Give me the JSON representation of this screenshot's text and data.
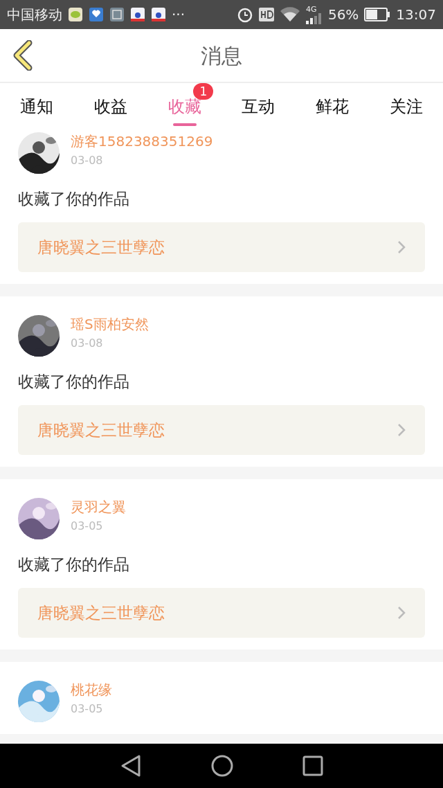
{
  "status_bar": {
    "carrier": "中国移动",
    "overflow": "···",
    "network": "4G",
    "battery": "56%",
    "time": "13:07"
  },
  "header": {
    "title": "消息"
  },
  "tabs": [
    {
      "label": "通知",
      "selected": false
    },
    {
      "label": "收益",
      "selected": false
    },
    {
      "label": "收藏",
      "selected": true,
      "badge": "1"
    },
    {
      "label": "互动",
      "selected": false
    },
    {
      "label": "鲜花",
      "selected": false
    },
    {
      "label": "关注",
      "selected": false
    }
  ],
  "messages": [
    {
      "user": "游客1582388351269",
      "date": "03-08",
      "action": "收藏了你的作品",
      "work": "唐晓翼之三世孽恋"
    },
    {
      "user": "瑶S雨柏安然",
      "date": "03-08",
      "action": "收藏了你的作品",
      "work": "唐晓翼之三世孽恋"
    },
    {
      "user": "灵羽之翼",
      "date": "03-05",
      "action": "收藏了你的作品",
      "work": "唐晓翼之三世孽恋"
    },
    {
      "user": "桃花缘",
      "date": "03-05"
    }
  ]
}
